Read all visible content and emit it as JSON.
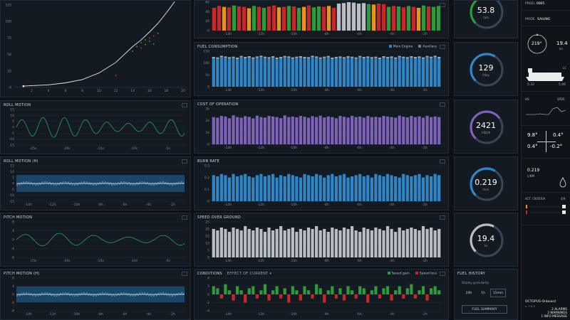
{
  "colors": {
    "bg": "#0c1117",
    "panel": "#131a22",
    "blue": "#2f86c6",
    "purple": "#7d62b8",
    "gray": "#b8bec4",
    "red": "#c8282a",
    "green": "#2e9a3a",
    "orange": "#e8941c",
    "white": "#e8ecef"
  },
  "top_left_chart": {
    "x_ticks": [
      "2",
      "4",
      "6",
      "8",
      "10",
      "12",
      "14",
      "16",
      "18",
      "20"
    ],
    "y_ticks": [
      "125",
      "100",
      "75",
      "50",
      "25",
      "0"
    ]
  },
  "roll_motion": {
    "title": "ROLL MOTION",
    "y_ticks": [
      "15",
      "10",
      "5",
      "0",
      "-5",
      "-10",
      "-15"
    ],
    "x_ticks": [
      "-25s",
      "-20s",
      "-15s",
      "-10s",
      "-5s"
    ]
  },
  "roll_motion_h": {
    "title": "ROLL MOTION (H)",
    "y_ticks": [
      "15",
      "10",
      "5",
      "0",
      "-5",
      "-10",
      "-15"
    ],
    "x_ticks": [
      "-14h",
      "-12h",
      "-10h",
      "-8h",
      "-6h",
      "-4h",
      "-2h"
    ]
  },
  "pitch_motion": {
    "title": "PITCH MOTION",
    "y_ticks": [
      "8",
      "4",
      "0",
      "-4",
      "-8"
    ],
    "x_ticks": [
      "-25s",
      "-20s",
      "-15s",
      "-10s",
      "-5s"
    ]
  },
  "pitch_motion_h": {
    "title": "PITCH MOTION (H)",
    "y_ticks": [
      "8",
      "4",
      "0",
      "-4",
      "-8"
    ],
    "x_ticks": [
      "-14h",
      "-12h",
      "-10h",
      "-8h",
      "-6h",
      "-4h",
      "-2h"
    ]
  },
  "top_bars": {
    "y_ticks": [
      "60",
      "40",
      "20",
      "0"
    ],
    "x_ticks": [
      "-14h",
      "-12h",
      "-10h",
      "-8h",
      "-6h",
      "-4h",
      "-2h"
    ]
  },
  "fuel_consumption": {
    "title": "FUEL CONSUMPTION",
    "legend_main": "Main Engine",
    "legend_aux": "Auxiliary",
    "y_ticks": [
      "150",
      "100",
      "50",
      "0"
    ],
    "x_ticks": [
      "-14h",
      "-12h",
      "-10h",
      "-8h",
      "-6h",
      "-4h",
      "-2h"
    ]
  },
  "cost_of_operation": {
    "title": "COST OF OPERATION",
    "y_ticks": [
      "3k",
      "2k",
      "1k",
      "0"
    ],
    "x_ticks": [
      "-14h",
      "-12h",
      "-10h",
      "-8h",
      "-6h",
      "-4h",
      "-2h"
    ]
  },
  "burn_rate": {
    "title": "BURN RATE",
    "y_ticks": [
      "0.3",
      "0.2",
      "0.1",
      "0"
    ],
    "x_ticks": [
      "-14h",
      "-12h",
      "-10h",
      "-8h",
      "-6h",
      "-4h",
      "-2h"
    ]
  },
  "speed_over_ground": {
    "title": "SPEED OVER GROUND",
    "y_ticks": [
      "25",
      "20",
      "15",
      "10",
      "5",
      "0"
    ],
    "x_ticks": [
      "-14h",
      "-12h",
      "-10h",
      "-8h",
      "-6h",
      "-4h",
      "-2h"
    ]
  },
  "conditions": {
    "title": "CONDITIONS",
    "dropdown": "EFFECT OF CURRENT",
    "legend_gain": "Speed gain",
    "legend_loss": "Speed loss",
    "y_ticks": [
      "4",
      "2",
      "0",
      "-2",
      "-4"
    ],
    "x_ticks": [
      "-14h",
      "-12h",
      "-10h",
      "-8h",
      "-6h",
      "-4h",
      "-2h"
    ]
  },
  "gauges": [
    {
      "value": "53.8",
      "unit": "rpm",
      "color": "#2e9a3a",
      "fraction": 0.55
    },
    {
      "value": "129",
      "unit": "l/day",
      "color": "#2f86c6",
      "fraction": 0.62
    },
    {
      "value": "2421",
      "unit": "USD/h",
      "color": "#7d62b8",
      "fraction": 0.7
    },
    {
      "value": "0.219",
      "unit": "l/nm",
      "color": "#2f86c6",
      "fraction": 0.62
    },
    {
      "value": "19.4",
      "unit": "kn",
      "color": "#b8bec4",
      "fraction": 0.6
    }
  ],
  "fuel_history": {
    "title": "FUEL HISTORY",
    "granularity_label": "Display granularity",
    "options": [
      "24h",
      "1h",
      "15min"
    ],
    "selected": "15min",
    "summary_button": "FUEL SUMMARY"
  },
  "sidebar": {
    "prog_label": "PROG:",
    "prog_value": "0005",
    "mode_label": "MODE",
    "mode_value": "SAILING",
    "heading": "219°",
    "speed": "19.4",
    "speed_unit": "kn",
    "vessel_id": "20383",
    "vessel_tag": "LC",
    "draft_fwd": "5.32",
    "draft_aft": "5.06",
    "hs_label": "HS",
    "spd_label": "SPDS",
    "roll_a": "9.8°",
    "roll_b": "0.4°",
    "pitch_a": "0.4°",
    "pitch_b": "-0.2°",
    "burn_value": "0.219",
    "burn_unit": "L/NM",
    "criteria_label": "ACT. CRITERIA",
    "criteria_value": "4/9",
    "app_name": "OCTOPUS-Onboard",
    "app_version": "v. 7.0.2",
    "alarms": "2 ALARMS",
    "warnings": "2 WARNINGS",
    "info": "1 INFO MESSAGE"
  },
  "chart_data": [
    {
      "type": "scatter",
      "x_range": [
        0,
        20
      ],
      "y_range": [
        0,
        125
      ],
      "curve": [
        [
          1,
          2
        ],
        [
          4,
          4
        ],
        [
          6,
          7
        ],
        [
          8,
          12
        ],
        [
          10,
          22
        ],
        [
          12,
          38
        ],
        [
          13,
          50
        ],
        [
          14,
          62
        ],
        [
          15,
          72
        ],
        [
          16,
          84
        ],
        [
          17,
          97
        ],
        [
          18,
          113
        ],
        [
          19,
          130
        ]
      ],
      "points": [
        [
          12,
          18
        ],
        [
          14,
          55
        ],
        [
          14.5,
          62
        ],
        [
          15,
          60
        ],
        [
          15,
          68
        ],
        [
          15.5,
          72
        ],
        [
          16,
          75
        ],
        [
          16,
          70
        ],
        [
          16.5,
          66
        ],
        [
          16.5,
          78
        ],
        [
          17,
          82
        ],
        [
          15.5,
          65
        ]
      ]
    },
    {
      "type": "bar",
      "name_ref": "top",
      "values": [
        48,
        52,
        50,
        49,
        53,
        51,
        50,
        47,
        52,
        50,
        48,
        51,
        53,
        49,
        50,
        52,
        51,
        48,
        50,
        53,
        49,
        51,
        50,
        52,
        48,
        57,
        58,
        60,
        59,
        57,
        58,
        56,
        55,
        57,
        56,
        50,
        52,
        51,
        49,
        52,
        50,
        48,
        53,
        51,
        50,
        52
      ],
      "colors": [
        "red",
        "red",
        "orange",
        "red",
        "green",
        "red",
        "red",
        "orange",
        "green",
        "red",
        "green",
        "red",
        "red",
        "orange",
        "red",
        "green",
        "red",
        "green",
        "orange",
        "red",
        "green",
        "green",
        "red",
        "orange",
        "red",
        "gray",
        "gray",
        "gray",
        "gray",
        "gray",
        "gray",
        "green",
        "orange",
        "red",
        "red",
        "green",
        "red",
        "green",
        "red",
        "green",
        "red",
        "orange",
        "green",
        "red",
        "green",
        "green"
      ]
    },
    {
      "type": "bar",
      "values": [
        120,
        118,
        125,
        122,
        119,
        121,
        117,
        124,
        120,
        123,
        118,
        122,
        125,
        121,
        119,
        123,
        117,
        120,
        124,
        122,
        118,
        121,
        123,
        120,
        119,
        125,
        122,
        118,
        121,
        124,
        117,
        120,
        122,
        119,
        123,
        121,
        118,
        124,
        120,
        122,
        119,
        121,
        117,
        123,
        120,
        122,
        118,
        124,
        121,
        119,
        123,
        120,
        122,
        118,
        124,
        121,
        125,
        120
      ]
    },
    {
      "type": "bar",
      "values": [
        2300,
        2250,
        2400,
        2350,
        2200,
        2450,
        2300,
        2250,
        2380,
        2320,
        2200,
        2420,
        2300,
        2260,
        2400,
        2350,
        2300,
        2210,
        2440,
        2300,
        2350,
        2280,
        2400,
        2330,
        2250,
        2380,
        2300,
        2420,
        2270,
        2350,
        2300,
        2200,
        2400,
        2330,
        2260,
        2410,
        2300,
        2350,
        2250,
        2390,
        2300,
        2320,
        2280,
        2400,
        2350,
        2300,
        2250,
        2420,
        2330,
        2280,
        2400,
        2300,
        2360,
        2250,
        2410,
        2300,
        2350,
        2300
      ]
    },
    {
      "type": "bar",
      "values": [
        0.22,
        0.21,
        0.23,
        0.22,
        0.2,
        0.23,
        0.21,
        0.22,
        0.23,
        0.21,
        0.2,
        0.22,
        0.23,
        0.21,
        0.22,
        0.23,
        0.2,
        0.22,
        0.21,
        0.23,
        0.22,
        0.21,
        0.2,
        0.23,
        0.22,
        0.21,
        0.23,
        0.22,
        0.2,
        0.22,
        0.23,
        0.21,
        0.22,
        0.23,
        0.2,
        0.21,
        0.22,
        0.23,
        0.21,
        0.22,
        0.2,
        0.23,
        0.22,
        0.21,
        0.23,
        0.22,
        0.21,
        0.2,
        0.23,
        0.22,
        0.21,
        0.22,
        0.23,
        0.2,
        0.22,
        0.21,
        0.23,
        0.22
      ]
    },
    {
      "type": "bar",
      "values": [
        20,
        19,
        21,
        20,
        18,
        21,
        20,
        19,
        22,
        20,
        19,
        21,
        20,
        18,
        21,
        19,
        20,
        22,
        19,
        20,
        21,
        18,
        20,
        19,
        21,
        20,
        22,
        19,
        20,
        18,
        21,
        20,
        19,
        21,
        20,
        22,
        19,
        18,
        21,
        20,
        19,
        21,
        20,
        19,
        22,
        20,
        18,
        21,
        19,
        20,
        21,
        20,
        19,
        22,
        20,
        21,
        19,
        20
      ]
    },
    {
      "type": "bar",
      "values": [
        2,
        1.5,
        -1,
        2.5,
        1,
        -1.5,
        2,
        1,
        -2,
        1.5,
        2,
        -1,
        1,
        2.5,
        -1.5,
        1,
        2,
        -1,
        1.5,
        -2,
        2,
        1,
        -1.5,
        2,
        1,
        -1,
        2.5,
        1.5,
        -2,
        1,
        2,
        -1,
        1.5,
        -1.5,
        2,
        1,
        -1,
        2,
        1.5,
        -2,
        1,
        2,
        -1,
        1.5,
        2,
        -1.5,
        1,
        2,
        -1,
        1.5,
        2.5,
        -1,
        1,
        2,
        -1.5,
        1.5,
        2,
        1
      ]
    }
  ]
}
